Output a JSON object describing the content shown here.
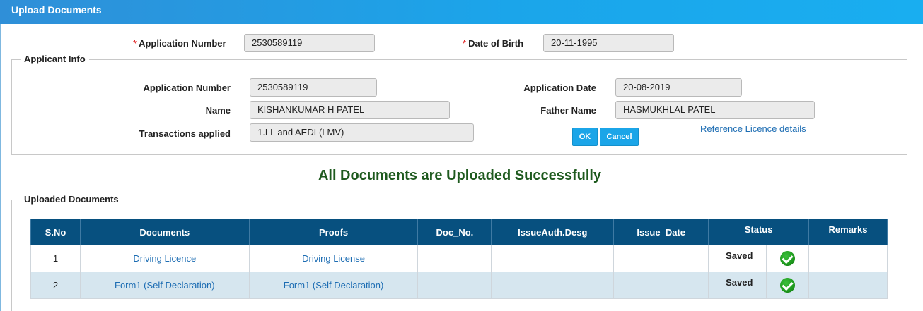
{
  "header": {
    "title": "Upload Documents"
  },
  "search": {
    "app_number_label": "Application Number",
    "app_number_value": "2530589119",
    "dob_label": "Date of Birth",
    "dob_value": "20-11-1995",
    "required_mark": "*"
  },
  "applicant_info": {
    "legend": "Applicant Info",
    "app_number_label": "Application Number",
    "app_number_value": "2530589119",
    "app_date_label": "Application Date",
    "app_date_value": "20-08-2019",
    "name_label": "Name",
    "name_value": "KISHANKUMAR H PATEL",
    "father_label": "Father Name",
    "father_value": "HASMUKHLAL  PATEL",
    "transactions_label": "Transactions applied",
    "transactions_value": "1.LL and AEDL(LMV)",
    "ok_label": "OK",
    "cancel_label": "Cancel",
    "reference_link": "Reference Licence details"
  },
  "message": "All Documents are Uploaded Successfully",
  "uploaded": {
    "legend": "Uploaded Documents",
    "columns": [
      "S.No",
      "Documents",
      "Proofs",
      "Doc_No.",
      "IssueAuth.Desg",
      "Issue  Date",
      "Status",
      "Remarks"
    ],
    "rows": [
      {
        "sno": "1",
        "document": "Driving Licence",
        "proof": "Driving License",
        "doc_no": "",
        "issue_auth": "",
        "issue_date": "",
        "status": "Saved",
        "remarks": ""
      },
      {
        "sno": "2",
        "document": "Form1 (Self Declaration)",
        "proof": "Form1 (Self Declaration)",
        "doc_no": "",
        "issue_auth": "",
        "issue_date": "",
        "status": "Saved",
        "remarks": ""
      }
    ]
  },
  "colors": {
    "header": "#1ba5ea",
    "table_header": "#07507f",
    "success": "#1e5a1e",
    "button": "#1ba5e8"
  }
}
